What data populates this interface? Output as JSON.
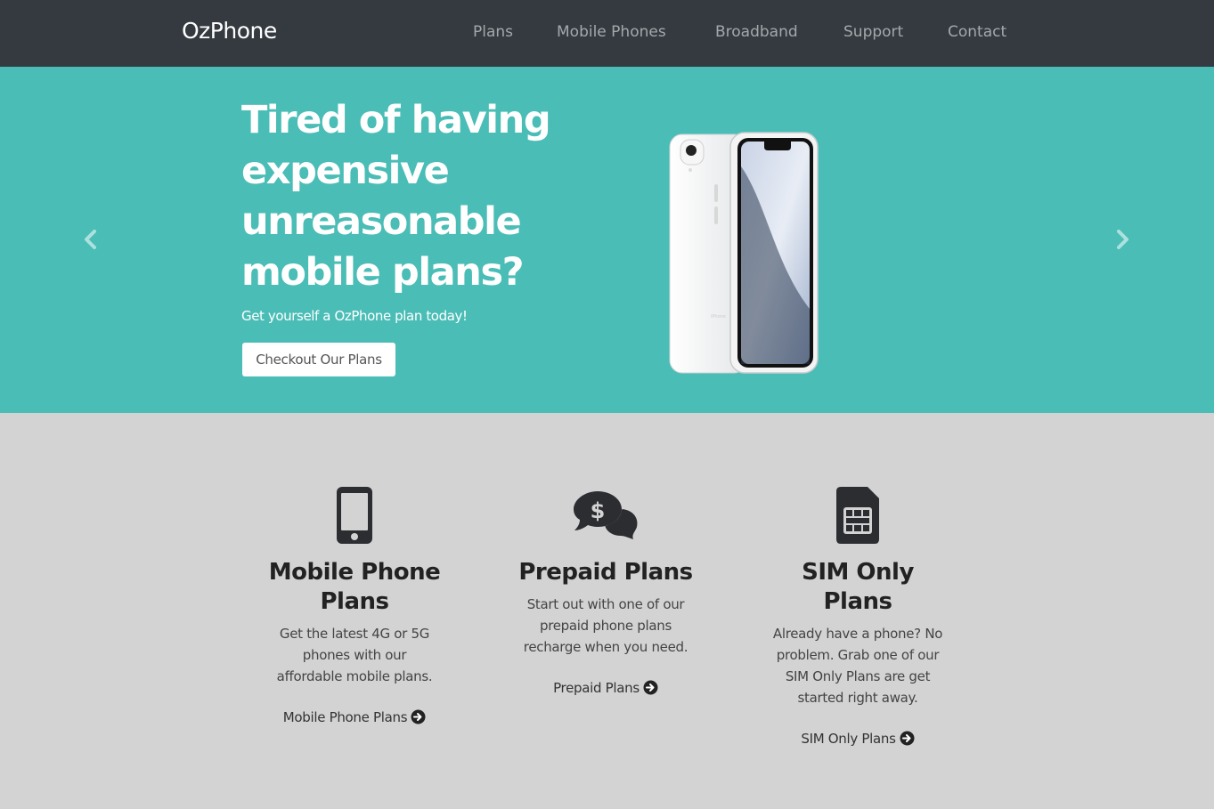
{
  "brand": {
    "name": "OzPhone"
  },
  "nav": {
    "items": [
      {
        "label": "Plans"
      },
      {
        "label": "Mobile Phones"
      },
      {
        "label": "Broadband"
      },
      {
        "label": "Support"
      },
      {
        "label": "Contact"
      }
    ]
  },
  "hero": {
    "title": "Tired of having expensive unreasonable mobile plans?",
    "subtitle": "Get yourself a OzPhone plan today!",
    "button_label": "Checkout Our Plans",
    "prev_icon": "chevron-left-icon",
    "next_icon": "chevron-right-icon",
    "image_icon": "smartphone-product-image",
    "phone_back_text": "iPhone"
  },
  "features": [
    {
      "icon": "mobile-phone-icon",
      "title": "Mobile Phone Plans",
      "description": "Get the latest 4G or 5G phones with our affordable mobile plans.",
      "link_label": "Mobile Phone Plans"
    },
    {
      "icon": "comments-dollar-icon",
      "title": "Prepaid Plans",
      "description": "Start out with one of our prepaid phone plans recharge when you need.",
      "link_label": "Prepaid Plans"
    },
    {
      "icon": "sim-card-icon",
      "title": "SIM Only Plans",
      "description": "Already have a phone? No problem. Grab one of our SIM Only Plans are get started right away.",
      "link_label": "SIM Only Plans"
    }
  ],
  "colors": {
    "navbar_bg": "#343a40",
    "hero_bg": "#4abdb6",
    "page_bg": "#d3d3d3",
    "icon_dark": "#2b2d31"
  }
}
